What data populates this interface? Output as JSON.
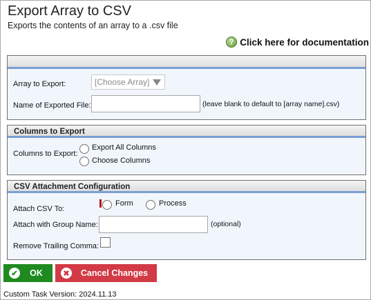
{
  "header": {
    "title": "Export Array to CSV",
    "subtitle": "Exports the contents of an array to a .csv file",
    "doc_link": "Click here for documentation"
  },
  "section_array": {
    "title": "",
    "array_label": "Array to Export:",
    "array_select_value": "[Choose Array]",
    "filename_label": "Name of Exported File:",
    "filename_value": "",
    "filename_hint": "(leave blank to default to [array name].csv)"
  },
  "section_columns": {
    "title": "Columns to Export",
    "label": "Columns to Export:",
    "option_all": "Export All Columns",
    "option_choose": "Choose Columns"
  },
  "section_csv": {
    "title": "CSV Attachment Configuration",
    "attach_label": "Attach CSV To:",
    "option_form": "Form",
    "option_process": "Process",
    "group_label": "Attach with Group Name:",
    "group_value": "",
    "group_hint": "(optional)",
    "trailing_label": "Remove Trailing Comma:"
  },
  "buttons": {
    "ok": "OK",
    "cancel": "Cancel Changes"
  },
  "footer": {
    "version": "Custom Task Version: 2024.11.13"
  },
  "colors": {
    "ok": "#1f8a1f",
    "cancel": "#d23a45",
    "section_bg": "#f1f6fd",
    "header_rule": "#7a9fd4"
  }
}
